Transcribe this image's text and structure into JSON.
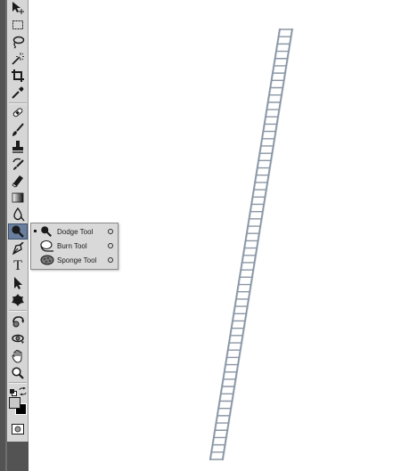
{
  "toolbar": {
    "tools": [
      {
        "id": "move",
        "icon": "move-icon"
      },
      {
        "id": "marquee",
        "icon": "rectangular-marquee-icon"
      },
      {
        "id": "lasso",
        "icon": "lasso-icon"
      },
      {
        "id": "quick-selection",
        "icon": "magic-wand-icon"
      },
      {
        "id": "crop",
        "icon": "crop-icon"
      },
      {
        "id": "eyedropper",
        "icon": "eyedropper-icon"
      },
      {
        "id": "healing",
        "icon": "healing-brush-icon"
      },
      {
        "id": "brush",
        "icon": "brush-icon"
      },
      {
        "id": "clone-stamp",
        "icon": "clone-stamp-icon"
      },
      {
        "id": "history-brush",
        "icon": "history-brush-icon"
      },
      {
        "id": "eraser",
        "icon": "eraser-icon"
      },
      {
        "id": "gradient",
        "icon": "gradient-icon"
      },
      {
        "id": "blur",
        "icon": "blur-icon"
      },
      {
        "id": "dodge",
        "icon": "dodge-icon",
        "active": true
      },
      {
        "id": "pen",
        "icon": "pen-icon"
      },
      {
        "id": "type",
        "icon": "type-icon",
        "glyph": "T"
      },
      {
        "id": "path-selection",
        "icon": "path-selection-icon"
      },
      {
        "id": "shape",
        "icon": "custom-shape-icon"
      },
      {
        "id": "3d-rotate",
        "icon": "3d-rotate-icon"
      },
      {
        "id": "3d-orbit",
        "icon": "3d-orbit-icon"
      },
      {
        "id": "hand",
        "icon": "hand-icon"
      },
      {
        "id": "zoom",
        "icon": "zoom-icon"
      }
    ],
    "foreground_color": "#000000",
    "background_color": "#c8c8c8"
  },
  "flyout": {
    "items": [
      {
        "label": "Dodge Tool",
        "shortcut_icon": "circle-icon",
        "selected": true
      },
      {
        "label": "Burn Tool",
        "shortcut_icon": "circle-icon",
        "selected": false
      },
      {
        "label": "Sponge Tool",
        "shortcut_icon": "circle-icon",
        "selected": false
      }
    ]
  },
  "canvas": {
    "background": "#ffffff",
    "object": "ladder",
    "ladder_color": "#8a96a4"
  }
}
